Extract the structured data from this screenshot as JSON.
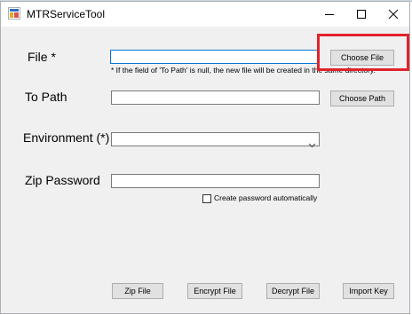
{
  "window": {
    "title": "MTRServiceTool",
    "app_icon": "app-window-icon",
    "controls": {
      "minimize_icon": "minimize-icon",
      "maximize_icon": "maximize-icon",
      "close_icon": "close-icon"
    }
  },
  "form": {
    "file": {
      "label": "File *",
      "value": "",
      "button_label": "Choose File",
      "hint": "* If the field of 'To Path' is null, the new file will be created in the same directory."
    },
    "to_path": {
      "label": "To Path",
      "value": "",
      "button_label": "Choose Path"
    },
    "environment": {
      "label": "Environment (*)",
      "selected": "",
      "dropdown_icon": "chevron-down-icon"
    },
    "zip_password": {
      "label": "Zip Password",
      "value": "",
      "checkbox_label": "Create password automatically",
      "checkbox_checked": false
    }
  },
  "actions": {
    "zip_file": "Zip File",
    "encrypt_file": "Encrypt File",
    "decrypt_file": "Decrypt File",
    "import_key": "Import Key"
  },
  "highlight_color": "#e0232b"
}
